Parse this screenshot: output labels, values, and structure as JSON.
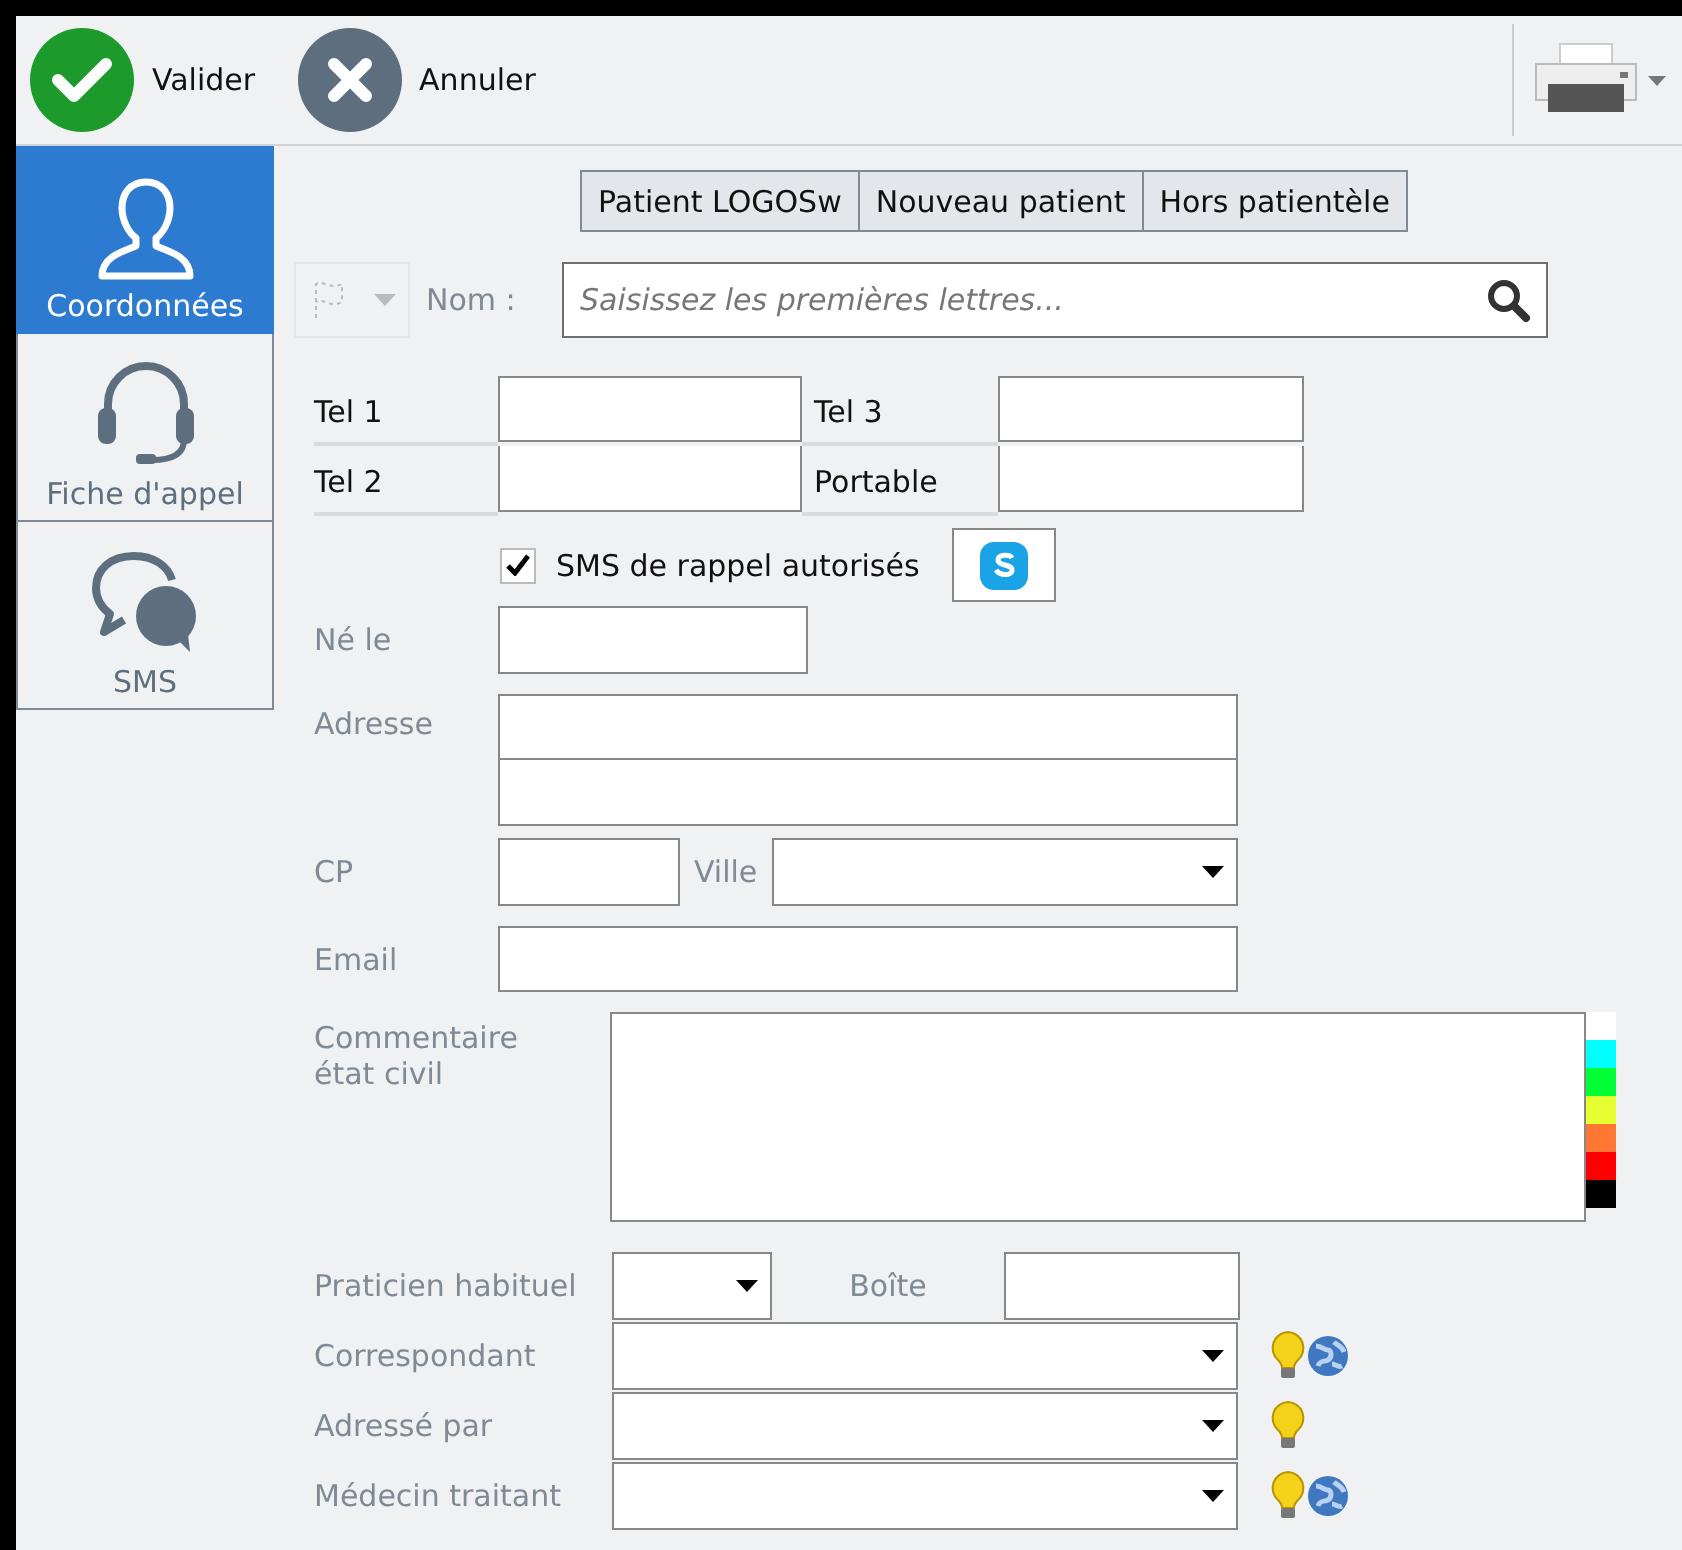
{
  "toolbar": {
    "buttons": [
      {
        "label": "Valider",
        "kind": "confirm"
      },
      {
        "label": "Annuler",
        "kind": "cancel"
      }
    ]
  },
  "sidebar": {
    "items": [
      {
        "label": "Coordonnées",
        "kind": "person",
        "selected": true
      },
      {
        "label": "Fiche d'appel",
        "kind": "headset",
        "selected": false
      },
      {
        "label": "SMS",
        "kind": "sms",
        "selected": false
      }
    ]
  },
  "patient_type_buttons": [
    "Patient LOGOSw",
    "Nouveau patient",
    "Hors patientèle"
  ],
  "search": {
    "label": "Nom :",
    "placeholder": "Saisissez les premières lettres..."
  },
  "phones": [
    {
      "label": "Tel 1"
    },
    {
      "label": "Tel 3"
    },
    {
      "label": "Tel 2"
    },
    {
      "label": "Portable"
    }
  ],
  "sms_reminder": {
    "label": "SMS de rappel autorisés",
    "checked": true
  },
  "birth": {
    "label": "Né le"
  },
  "address": {
    "label": "Adresse"
  },
  "postcode": {
    "label": "CP"
  },
  "city": {
    "label": "Ville"
  },
  "email": {
    "label": "Email"
  },
  "comment": {
    "label": "Commentaire état civil",
    "swatches": [
      {
        "color": "#ffffff"
      },
      {
        "color": "#00ffff"
      },
      {
        "color": "#00ff33"
      },
      {
        "color": "#e6ff33"
      },
      {
        "color": "#ff7733"
      },
      {
        "color": "#ff0000"
      },
      {
        "color": "#000000"
      }
    ]
  },
  "practitioner": {
    "label": "Praticien habituel"
  },
  "mailbox": {
    "label": "Boîte"
  },
  "referrals": [
    {
      "label": "Correspondant",
      "kind": "web"
    },
    {
      "label": "Adressé par",
      "kind": "local"
    },
    {
      "label": "Médecin traitant",
      "kind": "web"
    }
  ]
}
